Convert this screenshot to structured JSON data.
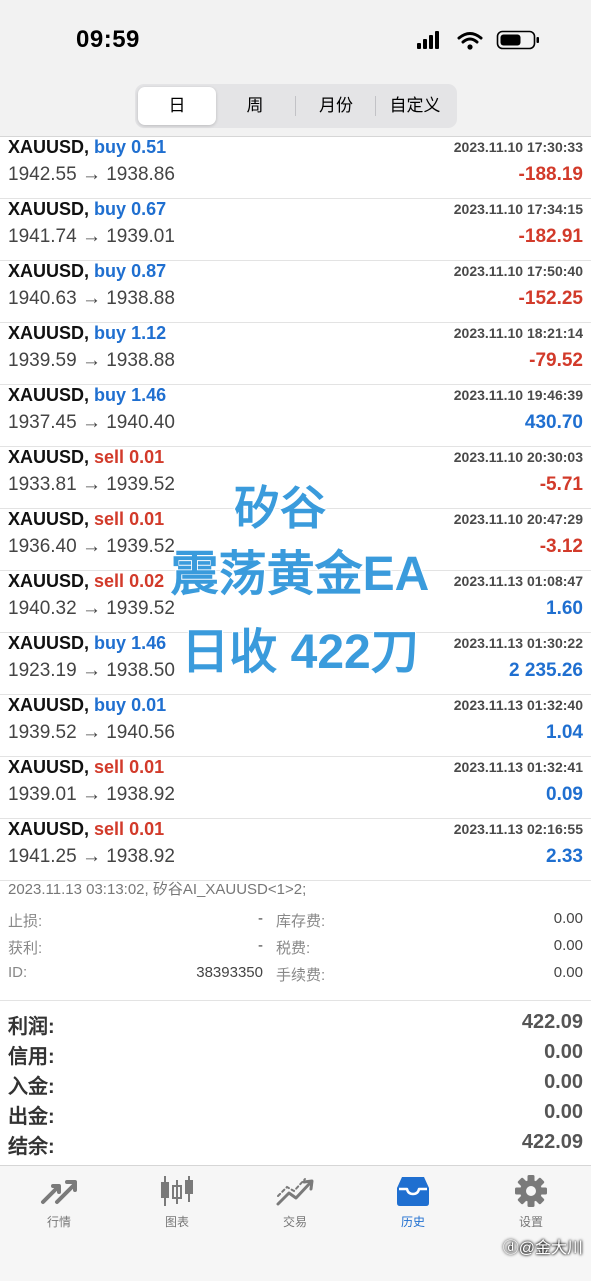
{
  "status_bar": {
    "time": "09:59"
  },
  "period_tabs": [
    {
      "label": "日",
      "active": true
    },
    {
      "label": "周",
      "active": false
    },
    {
      "label": "月份",
      "active": false
    },
    {
      "label": "自定义",
      "active": false
    }
  ],
  "trades": [
    {
      "symbol": "XAUUSD,",
      "side": "buy",
      "volume": "0.51",
      "time": "2023.11.10 17:30:33",
      "prices": "1942.55 → 1938.86",
      "profit": "-188.19"
    },
    {
      "symbol": "XAUUSD,",
      "side": "buy",
      "volume": "0.67",
      "time": "2023.11.10 17:34:15",
      "prices": "1941.74 → 1939.01",
      "profit": "-182.91"
    },
    {
      "symbol": "XAUUSD,",
      "side": "buy",
      "volume": "0.87",
      "time": "2023.11.10 17:50:40",
      "prices": "1940.63 → 1938.88",
      "profit": "-152.25"
    },
    {
      "symbol": "XAUUSD,",
      "side": "buy",
      "volume": "1.12",
      "time": "2023.11.10 18:21:14",
      "prices": "1939.59 → 1938.88",
      "profit": "-79.52"
    },
    {
      "symbol": "XAUUSD,",
      "side": "buy",
      "volume": "1.46",
      "time": "2023.11.10 19:46:39",
      "prices": "1937.45 → 1940.40",
      "profit": "430.70"
    },
    {
      "symbol": "XAUUSD,",
      "side": "sell",
      "volume": "0.01",
      "time": "2023.11.10 20:30:03",
      "prices": "1933.81 → 1939.52",
      "profit": "-5.71"
    },
    {
      "symbol": "XAUUSD,",
      "side": "sell",
      "volume": "0.01",
      "time": "2023.11.10 20:47:29",
      "prices": "1936.40 → 1939.52",
      "profit": "-3.12"
    },
    {
      "symbol": "XAUUSD,",
      "side": "sell",
      "volume": "0.02",
      "time": "2023.11.13 01:08:47",
      "prices": "1940.32 → 1939.52",
      "profit": "1.60"
    },
    {
      "symbol": "XAUUSD,",
      "side": "buy",
      "volume": "1.46",
      "time": "2023.11.13 01:30:22",
      "prices": "1923.19 → 1938.50",
      "profit": "2 235.26"
    },
    {
      "symbol": "XAUUSD,",
      "side": "buy",
      "volume": "0.01",
      "time": "2023.11.13 01:32:40",
      "prices": "1939.52 → 1940.56",
      "profit": "1.04"
    },
    {
      "symbol": "XAUUSD,",
      "side": "sell",
      "volume": "0.01",
      "time": "2023.11.13 01:32:41",
      "prices": "1939.01 → 1938.92",
      "profit": "0.09"
    },
    {
      "symbol": "XAUUSD,",
      "side": "sell",
      "volume": "0.01",
      "time": "2023.11.13 02:16:55",
      "prices": "1941.25 → 1938.92",
      "profit": "2.33"
    }
  ],
  "detail": {
    "comment": "2023.11.13 03:13:02, 矽谷AI_XAUUSD<1>2;",
    "stop_loss_label": "止损:",
    "stop_loss_value": "-",
    "take_profit_label": "获利:",
    "take_profit_value": "-",
    "id_label": "ID:",
    "id_value": "38393350",
    "swap_label": "库存费:",
    "swap_value": "0.00",
    "tax_label": "税费:",
    "tax_value": "0.00",
    "commission_label": "手续费:",
    "commission_value": "0.00"
  },
  "summary": [
    {
      "label": "利润:",
      "value": "422.09"
    },
    {
      "label": "信用:",
      "value": "0.00"
    },
    {
      "label": "入金:",
      "value": "0.00"
    },
    {
      "label": "出金:",
      "value": "0.00"
    },
    {
      "label": "结余:",
      "value": "422.09"
    }
  ],
  "tabbar": [
    {
      "label": "行情",
      "icon": "quotes-arrows-icon",
      "active": false
    },
    {
      "label": "图表",
      "icon": "candlestick-chart-icon",
      "active": false
    },
    {
      "label": "交易",
      "icon": "trade-trend-icon",
      "active": false
    },
    {
      "label": "历史",
      "icon": "history-inbox-icon",
      "active": true
    },
    {
      "label": "设置",
      "icon": "gear-icon",
      "active": false
    }
  ],
  "overlay": {
    "line1": "矽谷",
    "line2": "震荡黄金EA",
    "line3": "日收 422刀"
  },
  "watermark": "ⓓ@金大川",
  "colors": {
    "buy": "#1f6fd0",
    "sell": "#d23a2a",
    "active_tab": "#1f6fd0",
    "overlay_text": "#3a9bdc"
  }
}
